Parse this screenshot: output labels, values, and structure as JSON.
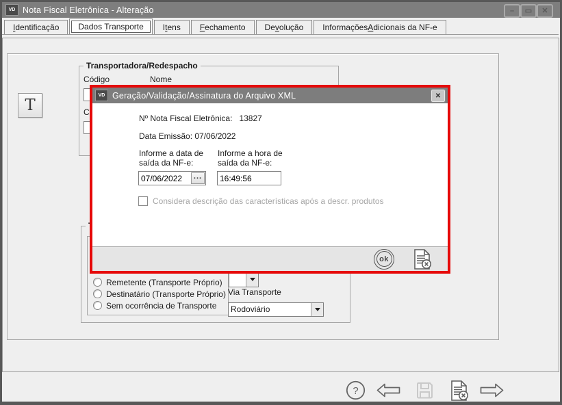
{
  "colors": {
    "accent_red": "#e60909",
    "titlebar_gray": "#7e7e7e",
    "frame_gray": "#585858",
    "content_bg": "#efefef",
    "footer_bg": "#e5e5e5",
    "disabled_text": "#a6a6a6",
    "icon_stroke": "#666666",
    "disabled_icon": "#c9c9c9"
  },
  "window": {
    "icon_text": "VD",
    "title": "Nota Fiscal Eletrônica - Alteração",
    "minimize_glyph": "–",
    "maximize_glyph": "▭",
    "close_glyph": "✕"
  },
  "tabs": [
    {
      "label": "Identificação",
      "underline": 0,
      "active": false
    },
    {
      "label": "Dados Transporte",
      "underline": -1,
      "active": true
    },
    {
      "label": "Itens",
      "underline": 1,
      "active": false
    },
    {
      "label": "Fechamento",
      "underline": 0,
      "active": false
    },
    {
      "label": "Devolução",
      "underline": 2,
      "active": false
    },
    {
      "label": "Informações Adicionais da NF-e",
      "underline": 12,
      "active": false
    }
  ],
  "content": {
    "t_button_label": "T",
    "group_transportadora": {
      "title": "Transportadora/Redespacho",
      "codigo_label": "Código",
      "nome_label": "Nome",
      "codigo2_label": "Có"
    },
    "group_transporte": {
      "title_visible": "Tr",
      "inner_title_visible": "F",
      "options": [
        "Remetente (Transporte Próprio)",
        "Destinatário (Transporte Próprio)",
        "Sem ocorrência de Transporte"
      ],
      "via_transporte_label": "Via Transporte",
      "via_transporte_value": "Rodoviário"
    }
  },
  "dialog": {
    "icon_text": "VD",
    "title": "Geração/Validação/Assinatura do Arquivo XML",
    "close_glyph": "✕",
    "nf_label": "Nº Nota Fiscal Eletrônica:",
    "nf_value": "13827",
    "emissao_label": "Data Emissão:",
    "emissao_value": "07/06/2022",
    "data_saida_label_l1": "Informe a data de",
    "data_saida_label_l2": "saída da NF-e:",
    "hora_saida_label_l1": "Informe a hora de",
    "hora_saida_label_l2": "saída da NF-e:",
    "data_saida_value": "07/06/2022",
    "browse_label": "...",
    "hora_saida_value": "16:49:56",
    "checkbox_label": "Considera descrição das características após a descr. produtos",
    "checkbox_checked": false,
    "ok_label": "ok",
    "footer_icons": [
      "ok-icon",
      "cancel-document-icon"
    ]
  },
  "toolbar": {
    "icons": [
      "help-icon",
      "back-icon",
      "save-icon",
      "cancel-document-icon",
      "forward-icon"
    ],
    "save_disabled": true
  }
}
